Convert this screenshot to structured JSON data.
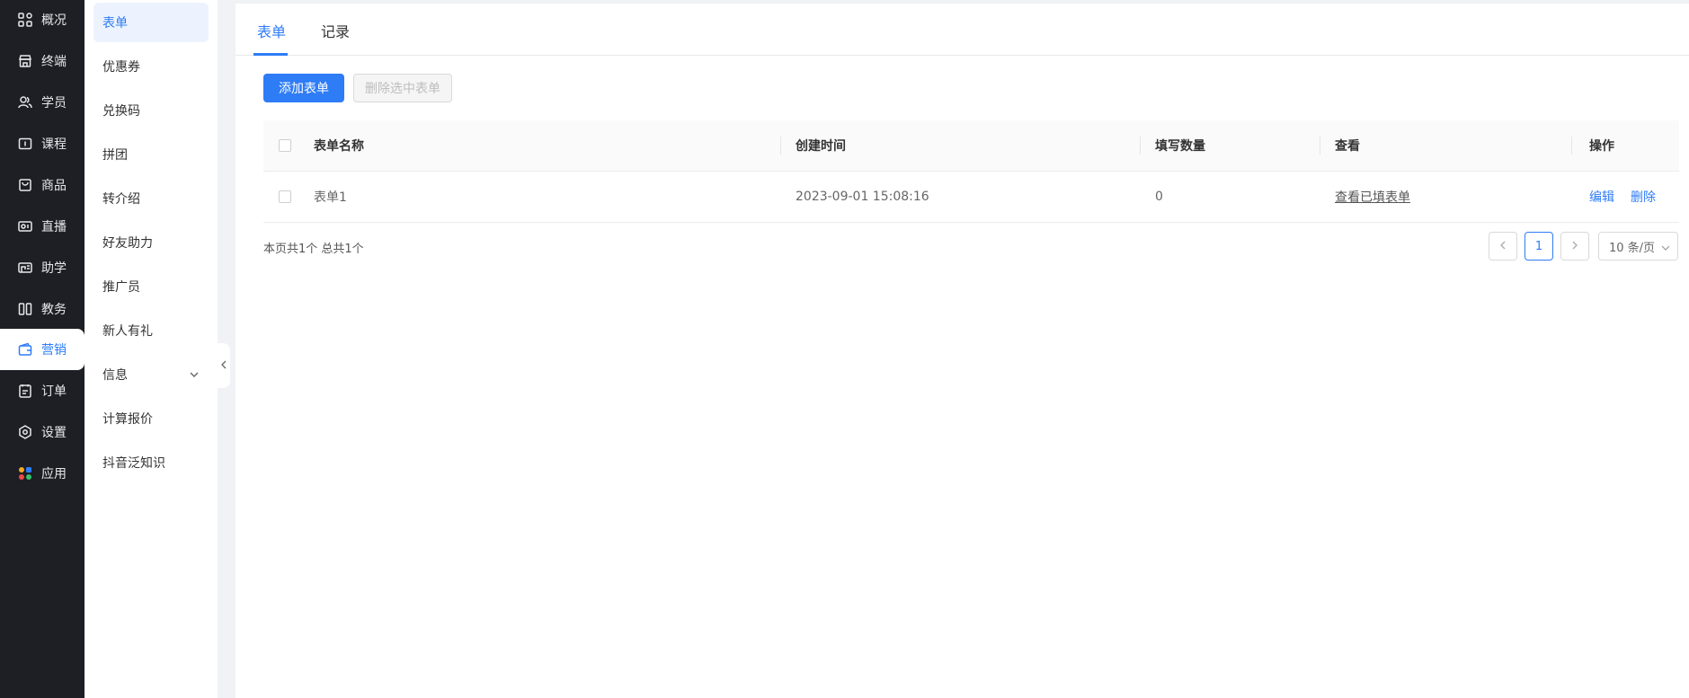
{
  "nav": {
    "items": [
      {
        "label": "概况",
        "icon": "grid-icon"
      },
      {
        "label": "终端",
        "icon": "store-icon"
      },
      {
        "label": "学员",
        "icon": "users-icon"
      },
      {
        "label": "课程",
        "icon": "course-icon"
      },
      {
        "label": "商品",
        "icon": "bag-icon"
      },
      {
        "label": "直播",
        "icon": "live-icon"
      },
      {
        "label": "助学",
        "icon": "assist-icon"
      },
      {
        "label": "教务",
        "icon": "book-icon"
      },
      {
        "label": "营销",
        "icon": "wallet-icon"
      },
      {
        "label": "订单",
        "icon": "order-icon"
      },
      {
        "label": "设置",
        "icon": "settings-icon"
      },
      {
        "label": "应用",
        "icon": "apps-icon"
      }
    ],
    "active": "营销",
    "accent_color": "#2e7cf6"
  },
  "submenu": {
    "items": [
      {
        "label": "表单"
      },
      {
        "label": "优惠券"
      },
      {
        "label": "兑换码"
      },
      {
        "label": "拼团"
      },
      {
        "label": "转介绍"
      },
      {
        "label": "好友助力"
      },
      {
        "label": "推广员"
      },
      {
        "label": "新人有礼"
      },
      {
        "label": "信息"
      },
      {
        "label": "计算报价"
      },
      {
        "label": "抖音泛知识"
      }
    ],
    "active": "表单"
  },
  "tabs": {
    "items": [
      {
        "label": "表单"
      },
      {
        "label": "记录"
      }
    ],
    "active": "表单"
  },
  "toolbar": {
    "add_label": "添加表单",
    "delete_label": "删除选中表单"
  },
  "table": {
    "columns": [
      "表单名称",
      "创建时间",
      "填写数量",
      "查看",
      "操作"
    ],
    "rows": [
      {
        "name": "表单1",
        "created": "2023-09-01 15:08:16",
        "count": "0",
        "view": "查看已填表单",
        "edit": "编辑",
        "delete": "删除"
      }
    ]
  },
  "pagination": {
    "summary": "本页共1个 总共1个",
    "current_page": "1",
    "page_size": "10 条/页"
  }
}
